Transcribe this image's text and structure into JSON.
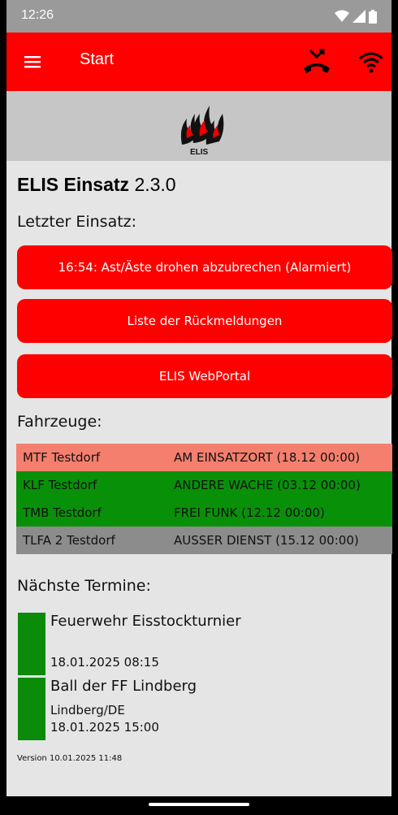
{
  "status_bar": {
    "time": "12:26"
  },
  "app_bar": {
    "title": "Start"
  },
  "logo": {
    "text": "ELIS"
  },
  "app": {
    "name": "ELIS Einsatz",
    "version": "2.3.0"
  },
  "last_incident": {
    "heading": "Letzter Einsatz:",
    "button_label": "16:54: Ast/Äste drohen abzubrechen (Alarmiert)"
  },
  "buttons": {
    "feedback_list": "Liste der Rückmeldungen",
    "webportal": "ELIS WebPortal"
  },
  "vehicles": {
    "heading": "Fahrzeuge:",
    "rows": [
      {
        "name": "MTF Testdorf",
        "status": "AM EINSATZORT (18.12 00:00)",
        "color": "#f47f6e"
      },
      {
        "name": "KLF Testdorf",
        "status": "ANDERE WACHE (03.12 00:00)",
        "color": "#089108"
      },
      {
        "name": "TMB Testdorf",
        "status": "FREI FUNK (12.12 00:00)",
        "color": "#089108"
      },
      {
        "name": "TLFA 2 Testdorf",
        "status": "AUSSER DIENST (15.12 00:00)",
        "color": "#8c8c8c"
      }
    ]
  },
  "events": {
    "heading": "Nächste Termine:",
    "items": [
      {
        "title": "Feuerwehr Eisstockturnier",
        "location": "",
        "date": "18.01.2025 08:15"
      },
      {
        "title": "Ball der FF Lindberg",
        "location": "Lindberg/DE",
        "date": "18.01.2025 15:00"
      }
    ]
  },
  "version_text": "Version 10.01.2025 11:48",
  "colors": {
    "accent": "#ff0000",
    "event_bar": "#0a8b0a",
    "background": "#e5e5e5"
  }
}
